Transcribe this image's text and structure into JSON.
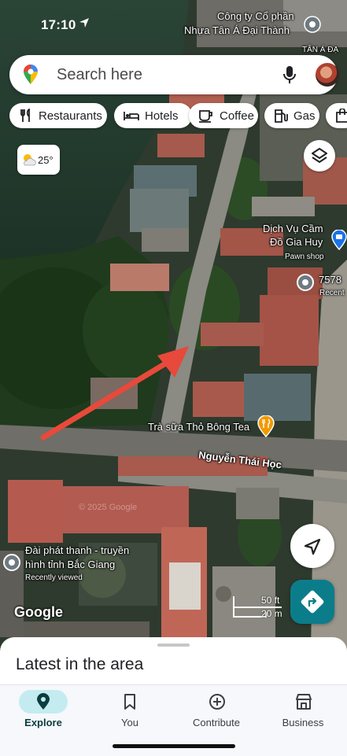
{
  "status_bar": {
    "time": "17:10"
  },
  "search": {
    "placeholder": "Search here"
  },
  "chips": [
    {
      "label": "Restaurants",
      "icon": "fork-knife-icon"
    },
    {
      "label": "Hotels",
      "icon": "bed-icon"
    },
    {
      "label": "Coffee",
      "icon": "coffee-cup-icon"
    },
    {
      "label": "Gas",
      "icon": "fuel-pump-icon"
    }
  ],
  "weather": {
    "temp": "25°",
    "icon": "partly-cloudy-icon"
  },
  "map_labels": {
    "company_line1": "Công ty Cổ phần",
    "company_line2": "Nhựa Tân Á Đại Thành",
    "tan_a": "TÂN Á ĐẠ",
    "dich_vu_line1": "Dịch Vụ Cầm",
    "dich_vu_line2": "Đồ Gia Huy",
    "pawn_shop": "Pawn shop",
    "poi_7578": "7578",
    "recent_1": "Recent",
    "tra_sua": "Trà sữa Thỏ Bông Tea",
    "street": "Nguyễn Thái Học",
    "radio_line1": "Đài phát thanh - truyền",
    "radio_line2": "hình tỉnh Bắc Giang",
    "recently_viewed": "Recently viewed",
    "watermark": "© 2025 Google",
    "google_logo": "Google",
    "scale_ft": "50 ft",
    "scale_m": "20 m"
  },
  "sheet": {
    "title": "Latest in the area"
  },
  "nav": [
    {
      "label": "Explore",
      "icon": "location-pin-icon",
      "active": true
    },
    {
      "label": "You",
      "icon": "bookmark-icon",
      "active": false
    },
    {
      "label": "Contribute",
      "icon": "add-circle-icon",
      "active": false
    },
    {
      "label": "Business",
      "icon": "storefront-icon",
      "active": false
    }
  ],
  "colors": {
    "accent": "#0b7d8a",
    "nav_active_bg": "#c4ecf0",
    "arrow": "#e8493a"
  }
}
